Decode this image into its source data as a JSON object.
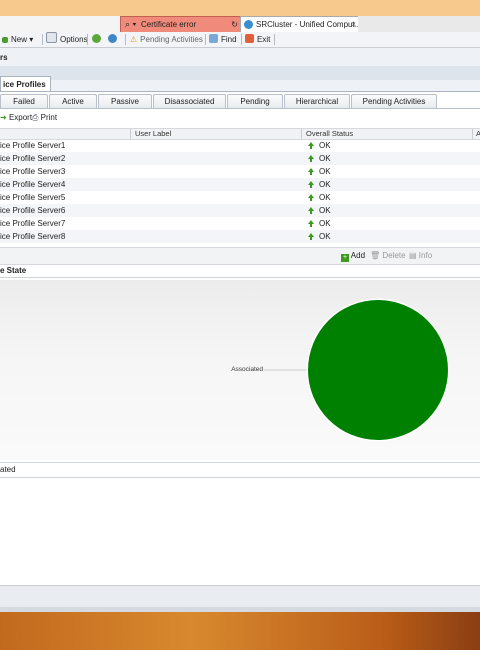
{
  "browser": {
    "address_icons": "⌕ ▾",
    "cert_label": "Certificate error",
    "tab_title": "SRCluster - Unified Comput...",
    "tab_close": "×"
  },
  "toolbar": {
    "new_label": "New ▾",
    "options_label": "Options",
    "pending_label": "Pending Activities",
    "find_label": "Find",
    "exit_label": "Exit"
  },
  "breadcrumb": "rs",
  "main_tab": "ice Profiles",
  "subtabs": [
    "Failed",
    "Active",
    "Passive",
    "Disassociated",
    "Pending",
    "Hierarchical",
    "Pending Activities"
  ],
  "actions": {
    "export_label": "Export",
    "print_label": "Print"
  },
  "table": {
    "headers": [
      "User Label",
      "Overall Status",
      "A"
    ],
    "rows": [
      {
        "name": "ice Profile Server1",
        "status": "OK"
      },
      {
        "name": "ice Profile Server2",
        "status": "OK"
      },
      {
        "name": "ice Profile Server3",
        "status": "OK"
      },
      {
        "name": "ice Profile Server4",
        "status": "OK"
      },
      {
        "name": "ice Profile Server5",
        "status": "OK"
      },
      {
        "name": "ice Profile Server6",
        "status": "OK"
      },
      {
        "name": "ice Profile Server7",
        "status": "OK"
      },
      {
        "name": "ice Profile Server8",
        "status": "OK"
      }
    ]
  },
  "buttons": {
    "add_label": "Add",
    "delete_label": "Delete",
    "info_label": "Info"
  },
  "pie_section_title": "e State",
  "pie": {
    "label": "Associated",
    "color": "#008000",
    "value": 1
  },
  "bottom_section_title": "ated",
  "colors": {
    "ok": "#3c9a1e",
    "pie": "#008000"
  }
}
